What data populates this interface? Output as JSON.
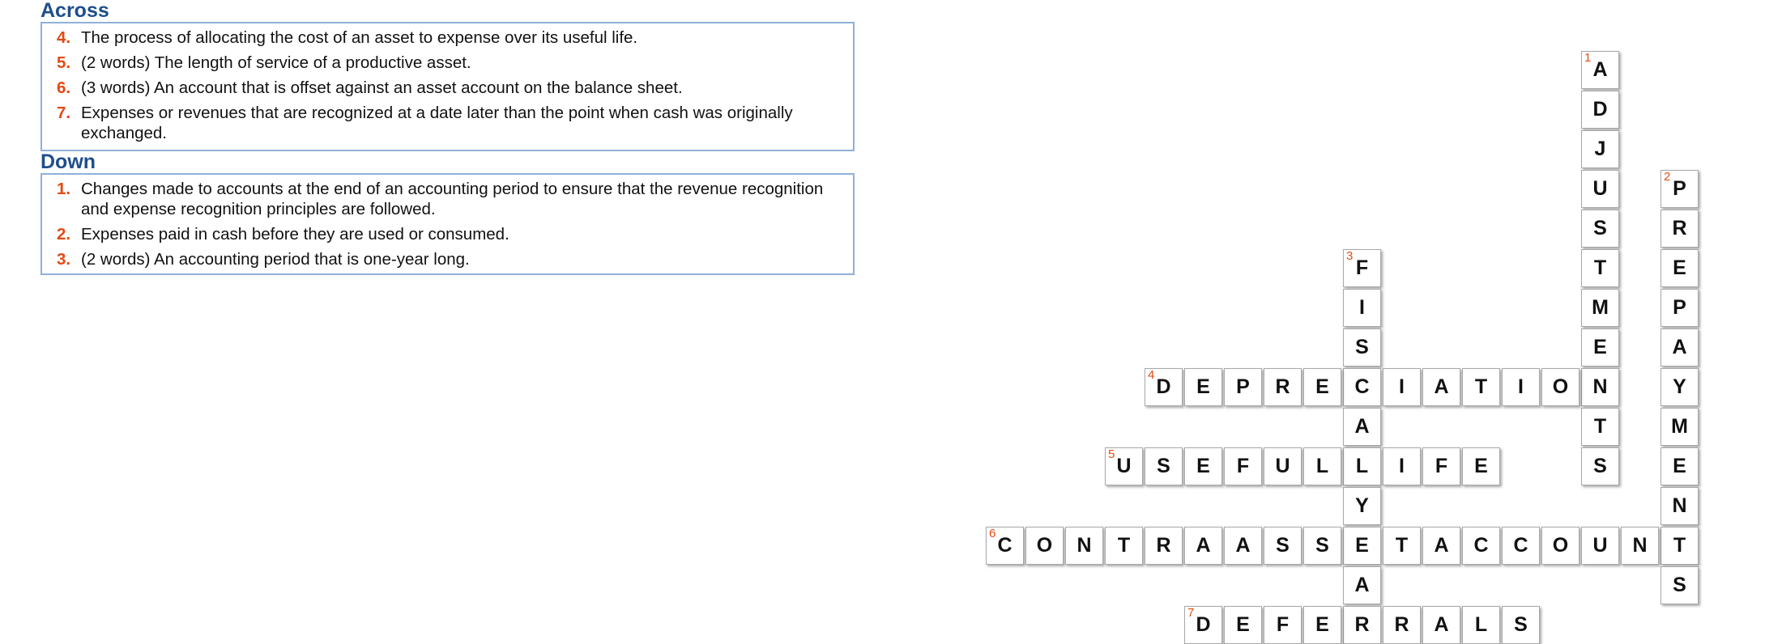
{
  "across_title": "Across",
  "down_title": "Down",
  "across": [
    {
      "num": "4.",
      "text": "The process of allocating the cost of an asset to expense over its useful life."
    },
    {
      "num": "5.",
      "text": "(2 words) The length of service of a productive asset."
    },
    {
      "num": "6.",
      "text": "(3 words) An account that is offset against an asset account on the balance sheet."
    },
    {
      "num": "7.",
      "text": "Expenses or revenues that are recognized at a date later than the point when cash was originally exchanged."
    }
  ],
  "down": [
    {
      "num": "1.",
      "text": "Changes made to accounts at the end of an accounting period to ensure that the revenue recognition and expense recognition principles are followed."
    },
    {
      "num": "2.",
      "text": "Expenses paid in cash before they are used or consumed."
    },
    {
      "num": "3.",
      "text": "(2 words) An accounting period that is one-year long."
    }
  ],
  "words": [
    {
      "id": "1",
      "dir": "down",
      "col": 15,
      "row": 0,
      "answer": "ADJUSTMENTS"
    },
    {
      "id": "2",
      "dir": "down",
      "col": 17,
      "row": 3,
      "answer": "PREPAYMENTS"
    },
    {
      "id": "3",
      "dir": "down",
      "col": 9,
      "row": 5,
      "answer": "FISCALYEAR"
    },
    {
      "id": "4",
      "dir": "across",
      "col": 4,
      "row": 8,
      "answer": "DEPRECIATION"
    },
    {
      "id": "5",
      "dir": "across",
      "col": 3,
      "row": 10,
      "answer": "USEFULLIFE"
    },
    {
      "id": "6",
      "dir": "across",
      "col": 0,
      "row": 12,
      "answer": "CONTRAASSETACCOUNT"
    },
    {
      "id": "7",
      "dir": "across",
      "col": 5,
      "row": 14,
      "answer": "DEFERRALS"
    }
  ]
}
